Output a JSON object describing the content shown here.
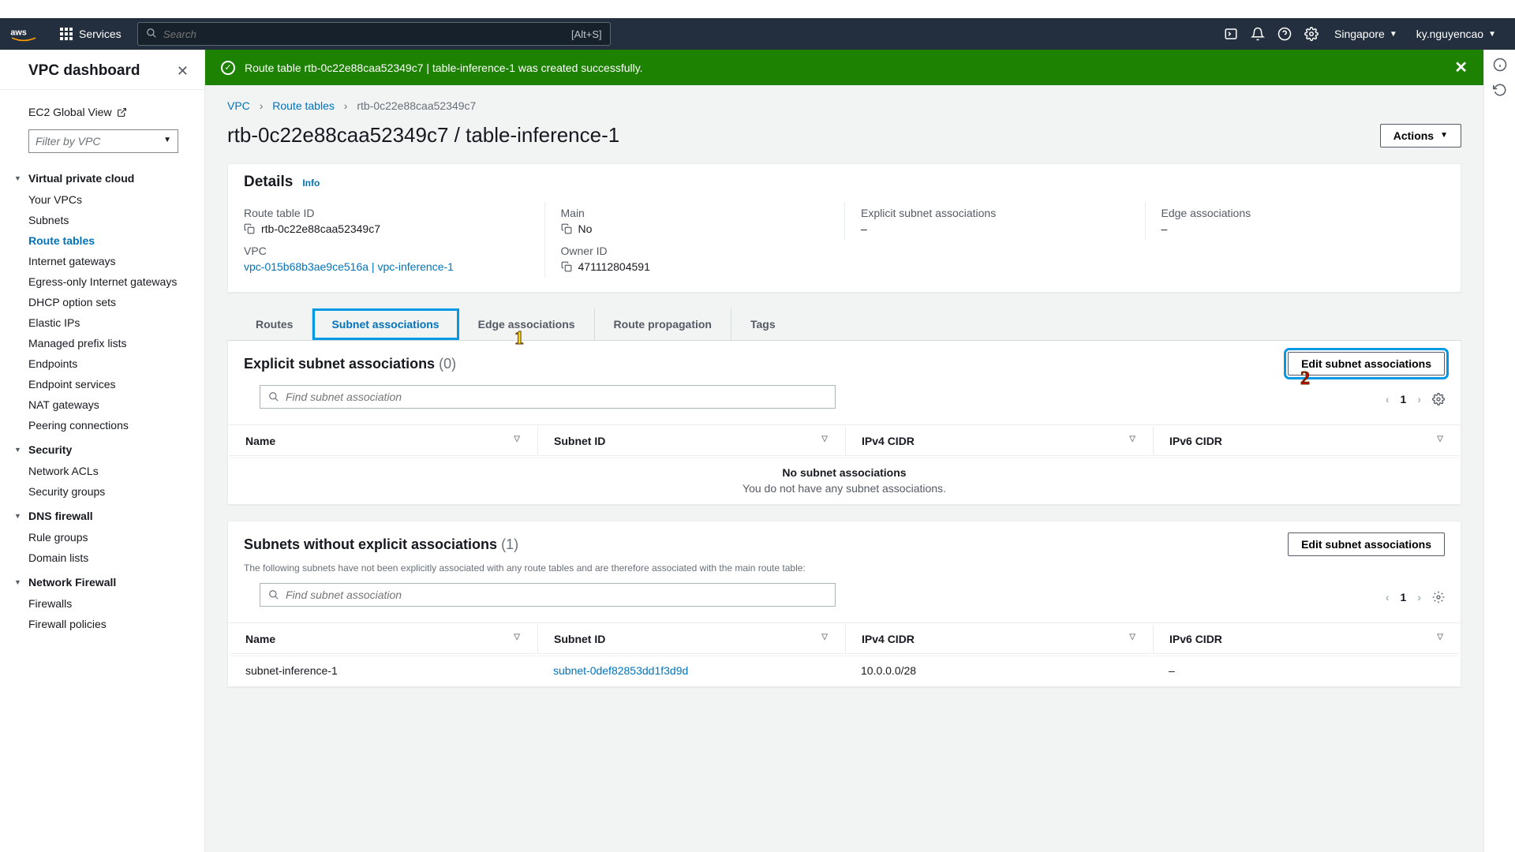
{
  "topbar": {
    "services_label": "Services",
    "search_placeholder": "Search",
    "search_shortcut": "[Alt+S]",
    "region": "Singapore",
    "user": "ky.nguyencao"
  },
  "sidebar": {
    "title": "VPC dashboard",
    "ec2_global": "EC2 Global View",
    "filter_placeholder": "Filter by VPC",
    "sections": [
      {
        "title": "Virtual private cloud",
        "items": [
          "Your VPCs",
          "Subnets",
          "Route tables",
          "Internet gateways",
          "Egress-only Internet gateways",
          "DHCP option sets",
          "Elastic IPs",
          "Managed prefix lists",
          "Endpoints",
          "Endpoint services",
          "NAT gateways",
          "Peering connections"
        ],
        "active_index": 2
      },
      {
        "title": "Security",
        "items": [
          "Network ACLs",
          "Security groups"
        ]
      },
      {
        "title": "DNS firewall",
        "items": [
          "Rule groups",
          "Domain lists"
        ]
      },
      {
        "title": "Network Firewall",
        "items": [
          "Firewalls",
          "Firewall policies"
        ]
      }
    ]
  },
  "alert": {
    "text": "Route table rtb-0c22e88caa52349c7 | table-inference-1 was created successfully."
  },
  "breadcrumbs": {
    "vpc": "VPC",
    "rt": "Route tables",
    "current": "rtb-0c22e88caa52349c7"
  },
  "page_title": "rtb-0c22e88caa52349c7 / table-inference-1",
  "actions_label": "Actions",
  "details": {
    "title": "Details",
    "info": "Info",
    "route_table_id_label": "Route table ID",
    "route_table_id": "rtb-0c22e88caa52349c7",
    "main_label": "Main",
    "main_value": "No",
    "explicit_label": "Explicit subnet associations",
    "explicit_value": "–",
    "edge_label": "Edge associations",
    "edge_value": "–",
    "vpc_label": "VPC",
    "vpc_value": "vpc-015b68b3ae9ce516a | vpc-inference-1",
    "owner_label": "Owner ID",
    "owner_value": "471112804591"
  },
  "tabs": [
    "Routes",
    "Subnet associations",
    "Edge associations",
    "Route propagation",
    "Tags"
  ],
  "explicit": {
    "title": "Explicit subnet associations",
    "count": "(0)",
    "edit_btn": "Edit subnet associations",
    "find_placeholder": "Find subnet association",
    "page": "1",
    "cols": [
      "Name",
      "Subnet ID",
      "IPv4 CIDR",
      "IPv6 CIDR"
    ],
    "empty_t1": "No subnet associations",
    "empty_t2": "You do not have any subnet associations."
  },
  "without": {
    "title": "Subnets without explicit associations",
    "count": "(1)",
    "desc": "The following subnets have not been explicitly associated with any route tables and are therefore associated with the main route table:",
    "edit_btn": "Edit subnet associations",
    "find_placeholder": "Find subnet association",
    "page": "1",
    "cols": [
      "Name",
      "Subnet ID",
      "IPv4 CIDR",
      "IPv6 CIDR"
    ],
    "row": {
      "name": "subnet-inference-1",
      "subnet_id": "subnet-0def82853dd1f3d9d",
      "ipv4": "10.0.0.0/28",
      "ipv6": "–"
    }
  },
  "annotations": {
    "one": "1",
    "two": "2"
  }
}
